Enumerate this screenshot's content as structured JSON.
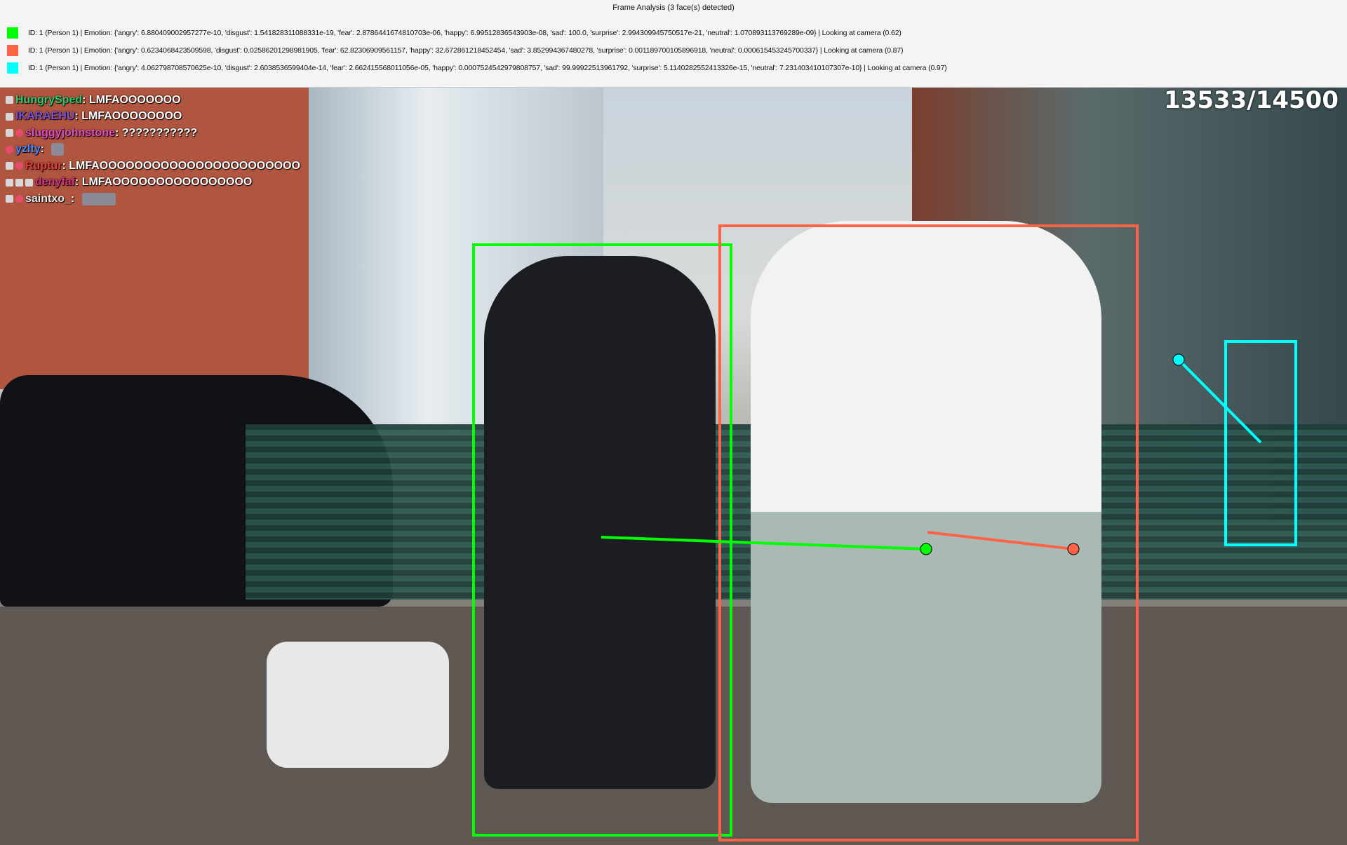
{
  "window": {
    "title": "Frame Analysis (3 face(s) detected)"
  },
  "faces": [
    {
      "color": "#00ff00",
      "text": "ID: 1 (Person 1) | Emotion: {'angry': 6.880409002957277e-10, 'disgust': 1.541828311088331e-19, 'fear': 2.8786441674810703e-06, 'happy': 6.99512836543903e-08, 'sad': 100.0, 'surprise': 2.994309945750517e-21, 'neutral': 1.070893113769289e-09} | Looking at camera (0.62)"
    },
    {
      "color": "#ff6347",
      "text": "ID: 1 (Person 1) | Emotion: {'angry': 0.6234068423509598, 'disgust': 0.02586201298981905, 'fear': 62.82306909561157, 'happy': 32.67286121845245​4, 'sad': 3.852994367480278, 'surprise': 0.0011897001058969​18, 'neutral': 0.0006154532457003​37} | Looking at camera (0.87)"
    },
    {
      "color": "#00ffff",
      "text": "ID: 1 (Person 1) | Emotion: {'angry': 4.062798708570625e-10, 'disgust': 2.6038536599404e-14, 'fear': 2.662415568011056e-05, 'happy': 0.0007524542979808757, 'sad': 99.99922513961792, 'surprise': 5.114028255241332​6e-15, 'neutral': 7.231403410107307e-10} | Looking at camera (0.97)"
    }
  ],
  "video": {
    "counter": "13533/14500",
    "chat": [
      {
        "user": "HungrySped",
        "user_color": "#2ecc71",
        "message": "LMFAOOOOOOO",
        "emote": false
      },
      {
        "user": "IKARAEHU",
        "user_color": "#7b52d6",
        "message": "LMFAOOOOOOOO",
        "emote": false
      },
      {
        "user": "sluggyjohnstone",
        "user_color": "#e14fbf",
        "message": "???????????",
        "emote": false
      },
      {
        "user": "yzlty",
        "user_color": "#4a8cff",
        "message": "",
        "emote": true
      },
      {
        "user": "Ruptur",
        "user_color": "#e84040",
        "message": "LMFAOOOOOOOOOOOOOOOOOOOOOOO",
        "emote": false
      },
      {
        "user": "denyfaf",
        "user_color": "#d63384",
        "message": "LMFAOOOOOOOOOOOOOOOO",
        "emote": false
      },
      {
        "user": "saintxo_",
        "user_color": "#e9e9e9",
        "message": "",
        "emote": true
      }
    ]
  }
}
